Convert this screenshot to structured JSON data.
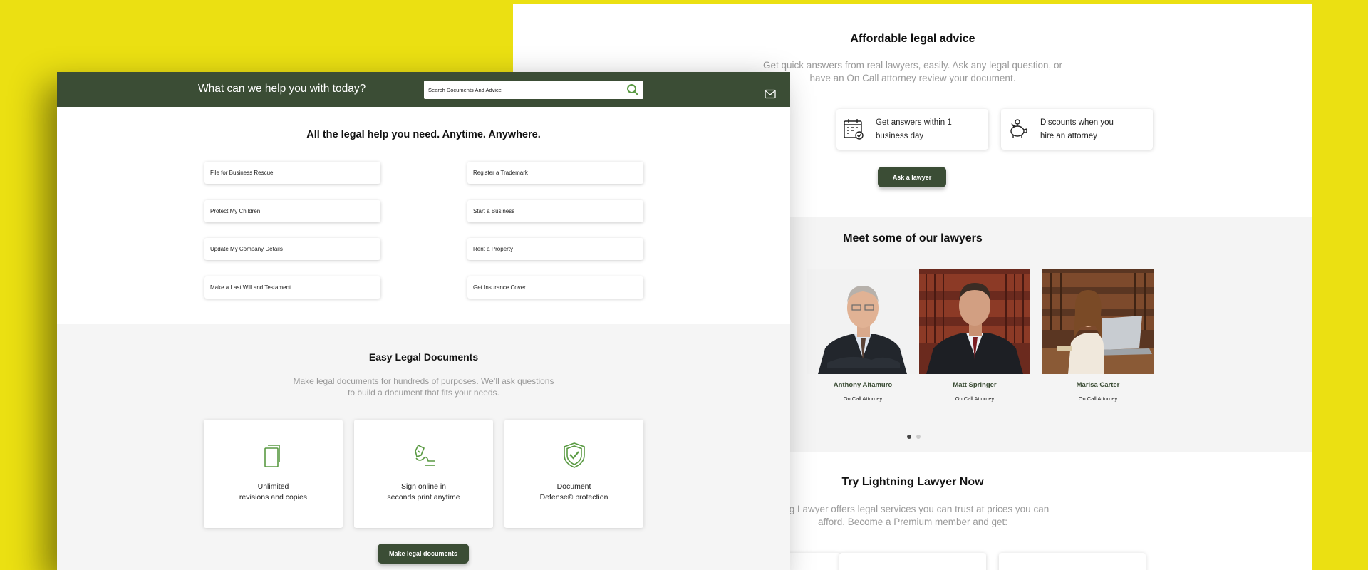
{
  "colors": {
    "background": "#ebe012",
    "brand_green": "#3b4d35",
    "accent_green": "#5a9a43"
  },
  "back": {
    "advice": {
      "title": "Affordable legal advice",
      "subtitle_line1": "Get quick answers from real lawyers, easily. Ask any legal question, or",
      "subtitle_line2": "have an On Call attorney review your document.",
      "features": [
        {
          "icon": "calendar-icon",
          "line1": "Get answers within 1",
          "line2": "business day"
        },
        {
          "icon": "piggy-bank-icon",
          "line1": "Discounts when you",
          "line2": "hire an attorney"
        }
      ],
      "ask_button": "Ask a lawyer"
    },
    "lawyers": {
      "title": "Meet some of our lawyers",
      "items": [
        {
          "name": "Anthony Altamuro",
          "role": "On Call Attorney"
        },
        {
          "name": "Matt Springer",
          "role": "On Call Attorney"
        },
        {
          "name": "Marisa Carter",
          "role": "On Call Attorney"
        }
      ]
    },
    "try": {
      "title": "Try Lightning Lawyer Now",
      "subtitle_line1": "ning Lawyer offers legal services you can trust at prices you can",
      "subtitle_line2": "afford. Become a Premium member and get:"
    }
  },
  "front": {
    "header": {
      "prompt": "What can we help you with today?",
      "search_placeholder": "Search Documents And Advice"
    },
    "help": {
      "title": "All the legal help you need. Anytime. Anywhere.",
      "links_left": [
        "File for Business Rescue",
        "Protect My Children",
        "Update My Company Details",
        "Make a Last Will and Testament"
      ],
      "links_right": [
        "Register a Trademark",
        "Start a Business",
        "Rent a Property",
        "Get Insurance Cover"
      ]
    },
    "documents": {
      "title": "Easy Legal Documents",
      "subtitle_line1": "Make legal documents for hundreds of purposes. We’ll ask questions",
      "subtitle_line2": "to build a document that fits your needs.",
      "cards": [
        {
          "icon": "copies-icon",
          "text": "Unlimited\nrevisions and copies"
        },
        {
          "icon": "signature-pen-icon",
          "text": "Sign online in\nseconds print anytime"
        },
        {
          "icon": "shield-check-icon",
          "text": "Document\nDefense® protection"
        }
      ],
      "button": "Make legal documents"
    }
  }
}
